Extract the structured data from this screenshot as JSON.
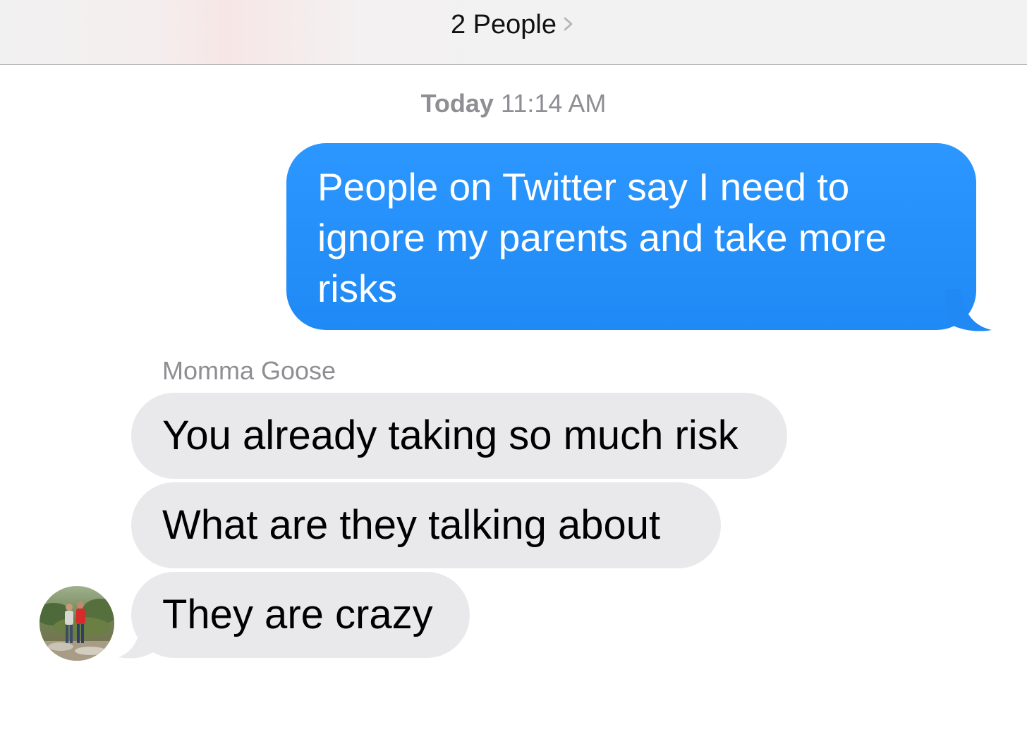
{
  "header": {
    "title": "2 People"
  },
  "conversation": {
    "timestamp_day": "Today",
    "timestamp_time": "11:14 AM",
    "sent": [
      {
        "line1": "People on Twitter say I need to",
        "line2": "ignore my parents and take more",
        "line3": "risks"
      }
    ],
    "sender_name": "Momma Goose",
    "received": [
      {
        "text": "You already taking so much risk"
      },
      {
        "text": "What are they talking about"
      },
      {
        "text": "They are crazy"
      }
    ]
  },
  "colors": {
    "sent_bubble": "#2391fb",
    "received_bubble": "#e9e9eb",
    "meta_text": "#8e8e93"
  },
  "icons": {
    "header_chevron": "chevron-right-icon",
    "avatar": "contact-photo"
  }
}
